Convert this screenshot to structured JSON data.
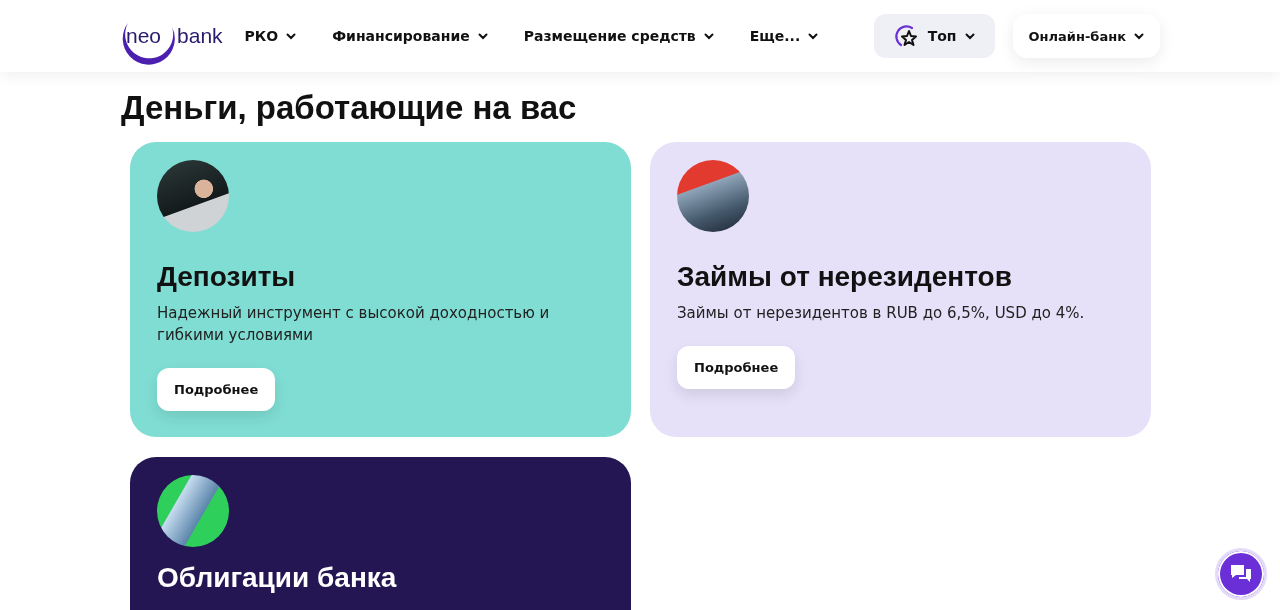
{
  "header": {
    "logo": {
      "left": "neo",
      "right": "bank"
    },
    "nav": [
      {
        "label": "РКО"
      },
      {
        "label": "Финансирование"
      },
      {
        "label": "Размещение средств"
      },
      {
        "label": "Еще..."
      }
    ],
    "top_button": {
      "label": "Топ"
    },
    "online_bank_button": {
      "label": "Онлайн-банк"
    }
  },
  "heading": "Деньги, работающие на вас",
  "cards": [
    {
      "kind": "light",
      "color": "#7fddd3",
      "title": "Депозиты",
      "text": "Надежный инструмент с высокой доходностью и гибкими условиями",
      "button": "Подробнее"
    },
    {
      "kind": "light",
      "color": "#e6e1f9",
      "title": "Займы от нерезидентов",
      "text": "Займы от нерезидентов в RUB до 6,5%, USD до 4%.",
      "button": "Подробнее"
    },
    {
      "kind": "dark",
      "color": "#231653",
      "title": "Облигации банка"
    }
  ]
}
